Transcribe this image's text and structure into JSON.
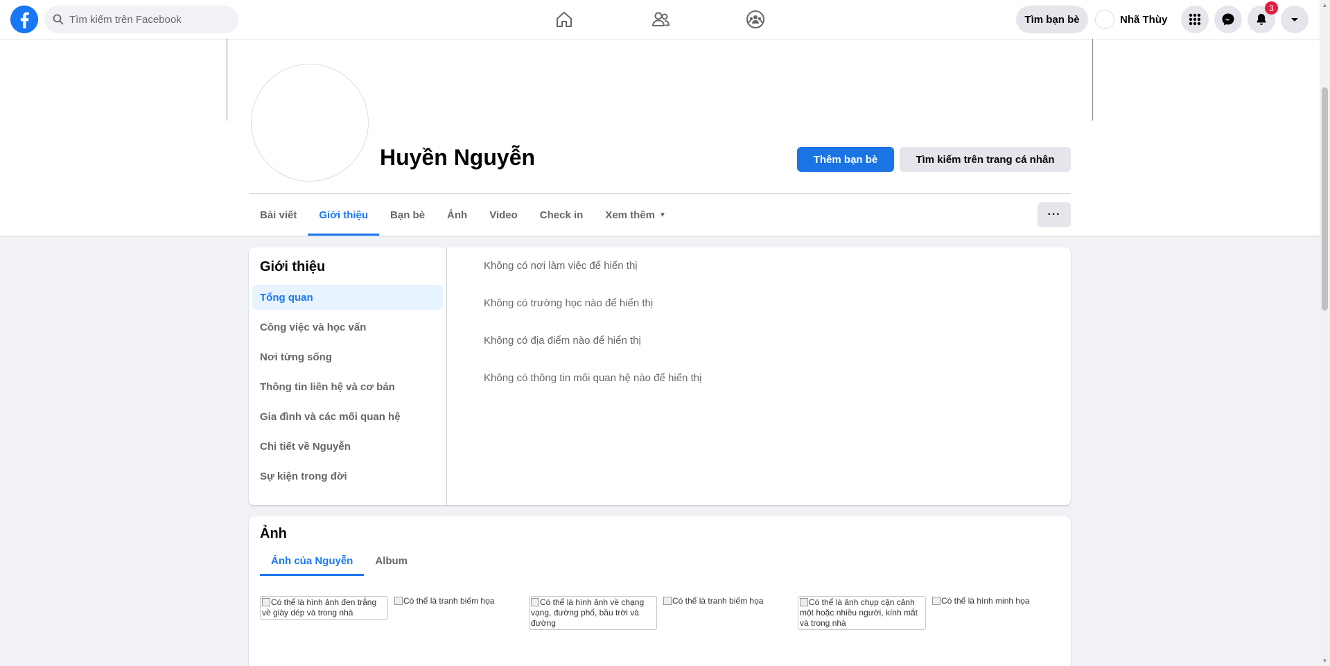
{
  "topbar": {
    "search_placeholder": "Tìm kiếm trên Facebook",
    "find_friends_label": "Tìm bạn bè",
    "user_name": "Nhã Thùy",
    "notification_count": "3",
    "brand_color": "#1877f2"
  },
  "profile": {
    "name": "Huyền Nguyễn",
    "add_friend_label": "Thêm bạn bè",
    "search_profile_label": "Tìm kiếm trên trang cá nhân",
    "more_label": "···",
    "tabs": [
      {
        "label": "Bài viết"
      },
      {
        "label": "Giới thiệu"
      },
      {
        "label": "Bạn bè"
      },
      {
        "label": "Ảnh"
      },
      {
        "label": "Video"
      },
      {
        "label": "Check in"
      },
      {
        "label": "Xem thêm"
      }
    ]
  },
  "about": {
    "title": "Giới thiệu",
    "nav": [
      {
        "label": "Tổng quan"
      },
      {
        "label": "Công việc và học vấn"
      },
      {
        "label": "Nơi từng sống"
      },
      {
        "label": "Thông tin liên hệ và cơ bản"
      },
      {
        "label": "Gia đình và các mối quan hệ"
      },
      {
        "label": "Chi tiết về Nguyễn"
      },
      {
        "label": "Sự kiện trong đời"
      }
    ],
    "lines": [
      "Không có nơi làm việc để hiển thị",
      "Không có trường học nào để hiển thị",
      "Không có địa điểm nào để hiển thị",
      "Không có thông tin mối quan hệ nào để hiển thị"
    ]
  },
  "photos": {
    "title": "Ảnh",
    "tabs": [
      {
        "label": "Ảnh của Nguyễn"
      },
      {
        "label": "Album"
      }
    ],
    "items": [
      "Có thể là hình ảnh đen trắng về giày dép và trong nhà",
      "Có thể là tranh biếm họa",
      "Có thể là hình ảnh về chạng vạng, đường phố, bầu trời và đường",
      "Có thể là tranh biếm họa",
      "Có thể là ảnh chụp cận cảnh một hoặc nhiều người, kính mắt và trong nhà",
      "Có thể là hình minh họa"
    ]
  }
}
